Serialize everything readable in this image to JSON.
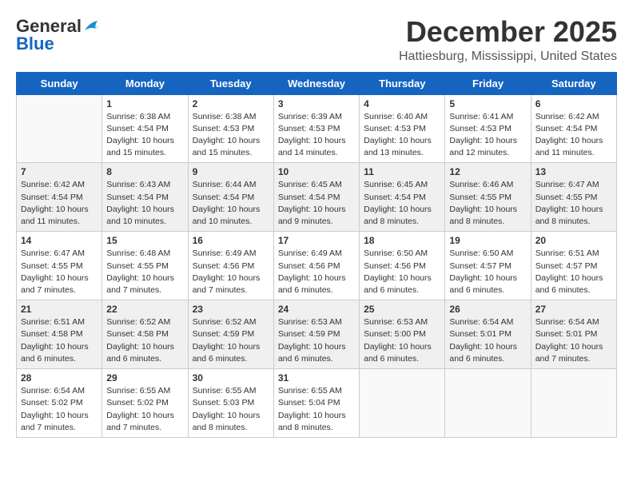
{
  "header": {
    "logo_general": "General",
    "logo_blue": "Blue",
    "month_title": "December 2025",
    "location": "Hattiesburg, Mississippi, United States"
  },
  "days_of_week": [
    "Sunday",
    "Monday",
    "Tuesday",
    "Wednesday",
    "Thursday",
    "Friday",
    "Saturday"
  ],
  "weeks": [
    [
      {
        "day": "",
        "sunrise": "",
        "sunset": "",
        "daylight": ""
      },
      {
        "day": "1",
        "sunrise": "Sunrise: 6:38 AM",
        "sunset": "Sunset: 4:54 PM",
        "daylight": "Daylight: 10 hours and 15 minutes."
      },
      {
        "day": "2",
        "sunrise": "Sunrise: 6:38 AM",
        "sunset": "Sunset: 4:53 PM",
        "daylight": "Daylight: 10 hours and 15 minutes."
      },
      {
        "day": "3",
        "sunrise": "Sunrise: 6:39 AM",
        "sunset": "Sunset: 4:53 PM",
        "daylight": "Daylight: 10 hours and 14 minutes."
      },
      {
        "day": "4",
        "sunrise": "Sunrise: 6:40 AM",
        "sunset": "Sunset: 4:53 PM",
        "daylight": "Daylight: 10 hours and 13 minutes."
      },
      {
        "day": "5",
        "sunrise": "Sunrise: 6:41 AM",
        "sunset": "Sunset: 4:53 PM",
        "daylight": "Daylight: 10 hours and 12 minutes."
      },
      {
        "day": "6",
        "sunrise": "Sunrise: 6:42 AM",
        "sunset": "Sunset: 4:54 PM",
        "daylight": "Daylight: 10 hours and 11 minutes."
      }
    ],
    [
      {
        "day": "7",
        "sunrise": "Sunrise: 6:42 AM",
        "sunset": "Sunset: 4:54 PM",
        "daylight": "Daylight: 10 hours and 11 minutes."
      },
      {
        "day": "8",
        "sunrise": "Sunrise: 6:43 AM",
        "sunset": "Sunset: 4:54 PM",
        "daylight": "Daylight: 10 hours and 10 minutes."
      },
      {
        "day": "9",
        "sunrise": "Sunrise: 6:44 AM",
        "sunset": "Sunset: 4:54 PM",
        "daylight": "Daylight: 10 hours and 10 minutes."
      },
      {
        "day": "10",
        "sunrise": "Sunrise: 6:45 AM",
        "sunset": "Sunset: 4:54 PM",
        "daylight": "Daylight: 10 hours and 9 minutes."
      },
      {
        "day": "11",
        "sunrise": "Sunrise: 6:45 AM",
        "sunset": "Sunset: 4:54 PM",
        "daylight": "Daylight: 10 hours and 8 minutes."
      },
      {
        "day": "12",
        "sunrise": "Sunrise: 6:46 AM",
        "sunset": "Sunset: 4:55 PM",
        "daylight": "Daylight: 10 hours and 8 minutes."
      },
      {
        "day": "13",
        "sunrise": "Sunrise: 6:47 AM",
        "sunset": "Sunset: 4:55 PM",
        "daylight": "Daylight: 10 hours and 8 minutes."
      }
    ],
    [
      {
        "day": "14",
        "sunrise": "Sunrise: 6:47 AM",
        "sunset": "Sunset: 4:55 PM",
        "daylight": "Daylight: 10 hours and 7 minutes."
      },
      {
        "day": "15",
        "sunrise": "Sunrise: 6:48 AM",
        "sunset": "Sunset: 4:55 PM",
        "daylight": "Daylight: 10 hours and 7 minutes."
      },
      {
        "day": "16",
        "sunrise": "Sunrise: 6:49 AM",
        "sunset": "Sunset: 4:56 PM",
        "daylight": "Daylight: 10 hours and 7 minutes."
      },
      {
        "day": "17",
        "sunrise": "Sunrise: 6:49 AM",
        "sunset": "Sunset: 4:56 PM",
        "daylight": "Daylight: 10 hours and 6 minutes."
      },
      {
        "day": "18",
        "sunrise": "Sunrise: 6:50 AM",
        "sunset": "Sunset: 4:56 PM",
        "daylight": "Daylight: 10 hours and 6 minutes."
      },
      {
        "day": "19",
        "sunrise": "Sunrise: 6:50 AM",
        "sunset": "Sunset: 4:57 PM",
        "daylight": "Daylight: 10 hours and 6 minutes."
      },
      {
        "day": "20",
        "sunrise": "Sunrise: 6:51 AM",
        "sunset": "Sunset: 4:57 PM",
        "daylight": "Daylight: 10 hours and 6 minutes."
      }
    ],
    [
      {
        "day": "21",
        "sunrise": "Sunrise: 6:51 AM",
        "sunset": "Sunset: 4:58 PM",
        "daylight": "Daylight: 10 hours and 6 minutes."
      },
      {
        "day": "22",
        "sunrise": "Sunrise: 6:52 AM",
        "sunset": "Sunset: 4:58 PM",
        "daylight": "Daylight: 10 hours and 6 minutes."
      },
      {
        "day": "23",
        "sunrise": "Sunrise: 6:52 AM",
        "sunset": "Sunset: 4:59 PM",
        "daylight": "Daylight: 10 hours and 6 minutes."
      },
      {
        "day": "24",
        "sunrise": "Sunrise: 6:53 AM",
        "sunset": "Sunset: 4:59 PM",
        "daylight": "Daylight: 10 hours and 6 minutes."
      },
      {
        "day": "25",
        "sunrise": "Sunrise: 6:53 AM",
        "sunset": "Sunset: 5:00 PM",
        "daylight": "Daylight: 10 hours and 6 minutes."
      },
      {
        "day": "26",
        "sunrise": "Sunrise: 6:54 AM",
        "sunset": "Sunset: 5:01 PM",
        "daylight": "Daylight: 10 hours and 6 minutes."
      },
      {
        "day": "27",
        "sunrise": "Sunrise: 6:54 AM",
        "sunset": "Sunset: 5:01 PM",
        "daylight": "Daylight: 10 hours and 7 minutes."
      }
    ],
    [
      {
        "day": "28",
        "sunrise": "Sunrise: 6:54 AM",
        "sunset": "Sunset: 5:02 PM",
        "daylight": "Daylight: 10 hours and 7 minutes."
      },
      {
        "day": "29",
        "sunrise": "Sunrise: 6:55 AM",
        "sunset": "Sunset: 5:02 PM",
        "daylight": "Daylight: 10 hours and 7 minutes."
      },
      {
        "day": "30",
        "sunrise": "Sunrise: 6:55 AM",
        "sunset": "Sunset: 5:03 PM",
        "daylight": "Daylight: 10 hours and 8 minutes."
      },
      {
        "day": "31",
        "sunrise": "Sunrise: 6:55 AM",
        "sunset": "Sunset: 5:04 PM",
        "daylight": "Daylight: 10 hours and 8 minutes."
      },
      {
        "day": "",
        "sunrise": "",
        "sunset": "",
        "daylight": ""
      },
      {
        "day": "",
        "sunrise": "",
        "sunset": "",
        "daylight": ""
      },
      {
        "day": "",
        "sunrise": "",
        "sunset": "",
        "daylight": ""
      }
    ]
  ]
}
